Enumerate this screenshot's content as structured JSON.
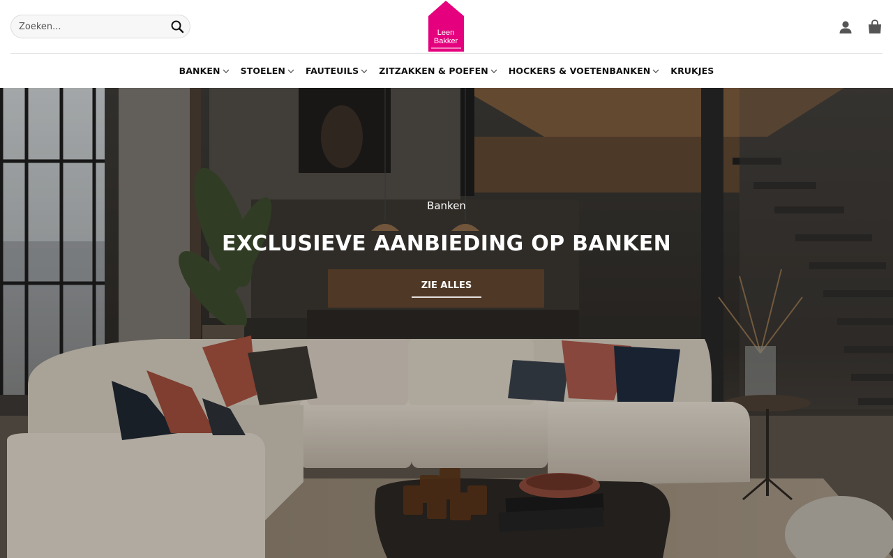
{
  "search": {
    "placeholder": "Zoeken..."
  },
  "logo": {
    "line1": "Leen",
    "line2": "Bakker",
    "color": "#e5007e"
  },
  "nav": {
    "items": [
      {
        "label": "BANKEN",
        "has_dropdown": true
      },
      {
        "label": "STOELEN",
        "has_dropdown": true
      },
      {
        "label": "FAUTEUILS",
        "has_dropdown": true
      },
      {
        "label": "ZITZAKKEN & POEFEN",
        "has_dropdown": true
      },
      {
        "label": "HOCKERS & VOETENBANKEN",
        "has_dropdown": true
      },
      {
        "label": "KRUKJES",
        "has_dropdown": false
      }
    ]
  },
  "icons": {
    "search": "search-icon",
    "account": "user-icon",
    "cart": "shopping-bag-icon",
    "dropdown": "chevron-down-icon"
  },
  "hero": {
    "subtitle": "Banken",
    "title": "EXCLUSIEVE AANBIEDING OP BANKEN",
    "cta": "ZIE ALLES"
  }
}
